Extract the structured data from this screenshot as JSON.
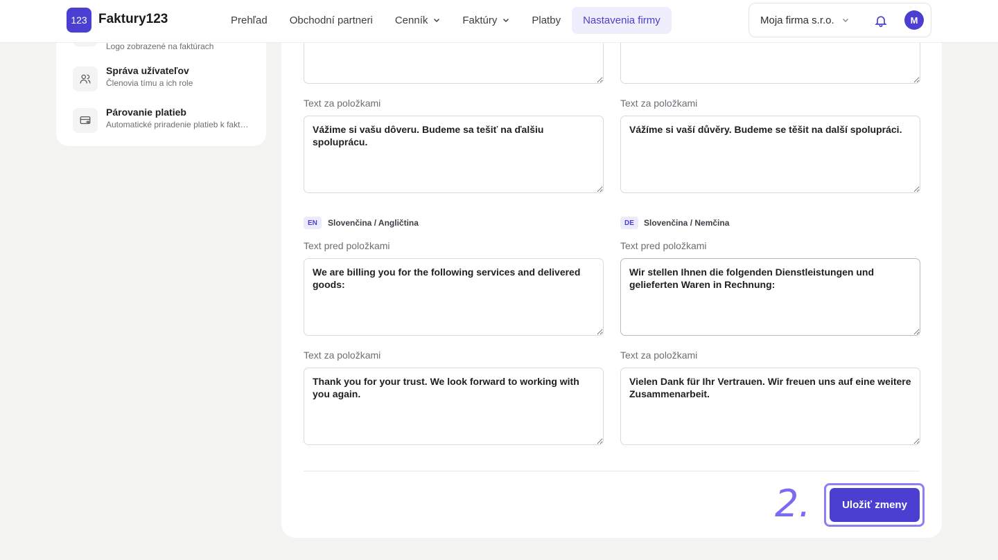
{
  "app": {
    "logo_badge": "123",
    "name": "Faktury123"
  },
  "nav": [
    {
      "label": "Prehľad"
    },
    {
      "label": "Obchodní partneri"
    },
    {
      "label": "Cenník"
    },
    {
      "label": "Faktúry"
    },
    {
      "label": "Platby"
    },
    {
      "label": "Nastavenia firmy"
    }
  ],
  "company": {
    "name": "Moja firma s.r.o.",
    "avatar_initial": "M"
  },
  "sidebar": {
    "items": [
      {
        "title": "",
        "subtitle": "Logo zobrazené na faktúrach",
        "icon": "image-icon"
      },
      {
        "title": "Správa užívateľov",
        "subtitle": "Členovia tímu a ich role",
        "icon": "users-icon"
      },
      {
        "title": "Párovanie platieb",
        "subtitle": "Automatické priradenie platieb k faktúram",
        "icon": "payment-match-icon"
      }
    ]
  },
  "form": {
    "top_left_after": {
      "label": "Text za položkami",
      "value": "Vážime si vašu dôveru. Budeme sa tešiť na ďalšiu spoluprácu."
    },
    "top_right_after": {
      "label": "Text za položkami",
      "value": "Vážíme si vaší důvěry. Budeme se těšit na další spolupráci."
    },
    "en": {
      "code": "EN",
      "title": "Slovenčina / Angličtina",
      "before_label": "Text pred položkami",
      "before_value": "We are billing you for the following services and delivered goods:",
      "after_label": "Text za položkami",
      "after_value": "Thank you for your trust. We look forward to working with you again."
    },
    "de": {
      "code": "DE",
      "title": "Slovenčina / Nemčina",
      "before_label": "Text pred položkami",
      "before_value": "Wir stellen Ihnen die folgenden Dienstleistungen und gelieferten Waren in Rechnung:",
      "after_label": "Text za položkami",
      "after_value": "Vielen Dank für Ihr Vertrauen. Wir freuen uns auf eine weitere Zusammenarbeit."
    }
  },
  "annotation": "2.",
  "save_label": "Uložiť zmeny",
  "colors": {
    "accent": "#4a3fd1",
    "accent_light": "#eeeefc",
    "annotation": "#7a6cf0"
  }
}
